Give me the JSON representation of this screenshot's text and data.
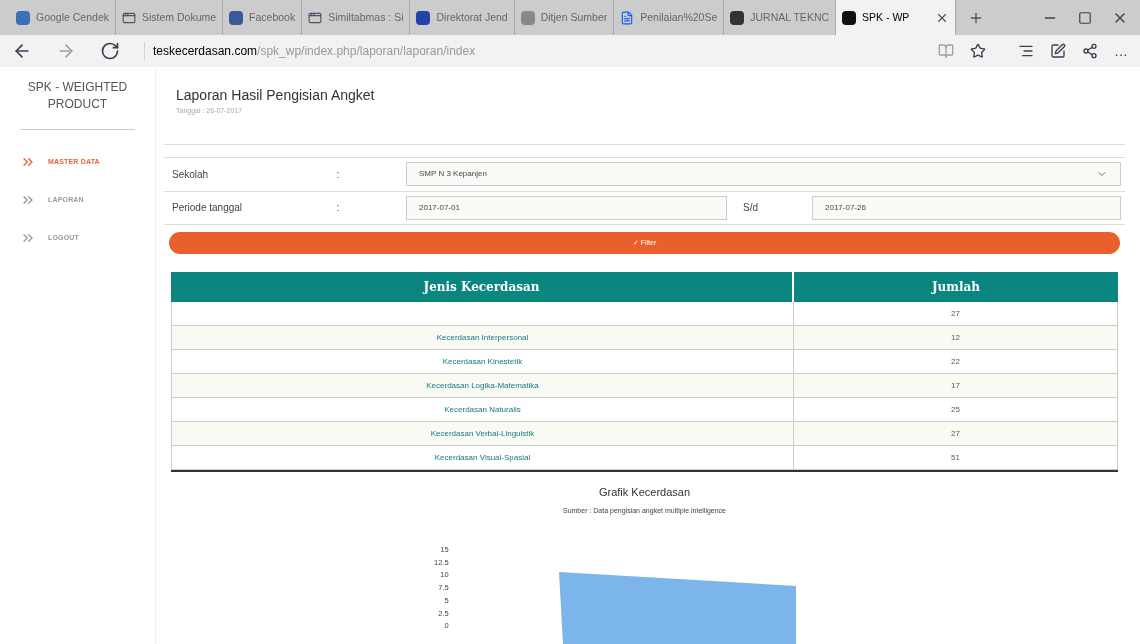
{
  "browser": {
    "tabs": [
      {
        "label": "Google Cendek",
        "kind": "favicon",
        "selected": false
      },
      {
        "label": "Sistem Dokume",
        "kind": "window",
        "selected": false
      },
      {
        "label": "Facebook",
        "kind": "favicon",
        "selected": false
      },
      {
        "label": "Similtabmas : Si",
        "kind": "window",
        "selected": false
      },
      {
        "label": "Direktorat Jend",
        "kind": "favicon",
        "selected": false
      },
      {
        "label": "Ditjen Sumber",
        "kind": "favicon",
        "selected": false
      },
      {
        "label": "Penilaian%20Se",
        "kind": "document",
        "selected": false
      },
      {
        "label": "JURNAL TEKNC",
        "kind": "favicon",
        "selected": false
      },
      {
        "label": "SPK - WP",
        "kind": "favicon",
        "selected": true
      }
    ],
    "url_domain": "teskecerdasan.com",
    "url_path": "/spk_wp/index.php/laporan/laporan/index",
    "more": "…"
  },
  "sidebar": {
    "brand": "SPK - WEIGHTED PRODUCT",
    "items": [
      {
        "label": "MASTER DATA",
        "selected": true
      },
      {
        "label": "LAPORAN",
        "selected": false
      },
      {
        "label": "LOGOUT",
        "selected": false
      }
    ]
  },
  "header": {
    "title": "Laporan Hasil Pengisian Angket",
    "date": "Tanggal : 26-07-2017"
  },
  "form": {
    "school_label": "Sekolah",
    "colon": ":",
    "school_value": "SMP N 3 Kepanjen",
    "period_label": "Periode tanggal",
    "period_colon": ":",
    "date_from": "2017-07-01",
    "until_label": "S/d",
    "date_to": "2017-07-26",
    "filter_button": "✓ Filter"
  },
  "table": {
    "columns": [
      "Jenis Kecerdasan",
      "Jumlah"
    ],
    "rows": [
      {
        "jumlah": "27"
      },
      {
        "jenis": "Kecerdasan Interpersonal",
        "jumlah": "12"
      },
      {
        "jenis": "Kecerdasan Kinestetik",
        "jumlah": "22"
      },
      {
        "jenis": "Kecerdasan Logika-Matematika",
        "jumlah": "17"
      },
      {
        "jenis": "Kecerdasan Naturalis",
        "jumlah": "25"
      },
      {
        "jenis": "Kecerdasan Verbal-Linguistik",
        "jumlah": "27"
      },
      {
        "jenis": "Kecerdasan Visual-Spasial",
        "jumlah": "51"
      }
    ]
  },
  "chart": {
    "title": "Grafik Kecerdasan",
    "subtitle": "Sumber : Data pengisian angket multiple intelligence",
    "yticks": [
      "15",
      "12.5",
      "10",
      "7.5",
      "5",
      "2.5",
      "0"
    ]
  }
}
